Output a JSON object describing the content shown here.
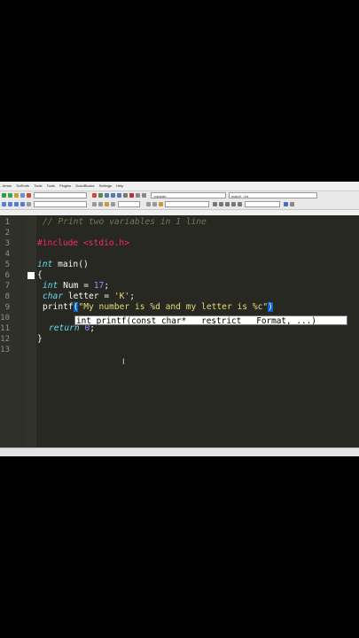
{
  "menu": [
    "...itman",
    "SciSmth",
    "Tools",
    "Tools",
    "Plugins",
    "DocuBlocks",
    "Settings",
    "Help"
  ],
  "toolbar": {
    "scope_combo": "<global>",
    "function_combo": "main() : int"
  },
  "editor": {
    "line_numbers": [
      "1",
      "2",
      "3",
      "4",
      "5",
      "6",
      "7",
      "8",
      "9",
      "10",
      "11",
      "12",
      "13"
    ],
    "line1_comment": "// Print two variables in 1 line",
    "line3_hash": "#",
    "line3_include": "include",
    "line3_header": "<stdio.h>",
    "line5_type": "int",
    "line5_rest": " main()",
    "line6_brace": "{",
    "line7_type": "int",
    "line7_rest": " Num = ",
    "line7_num": "17",
    "line7_semi": ";",
    "line8_type": "char",
    "line8_rest": " letter = ",
    "line8_char": "'K'",
    "line8_semi": ";",
    "line9_func": "printf",
    "line9_open": "(",
    "line9_string": "\"My number is %d and my letter is %c\"",
    "line9_close": ")",
    "line10_kw": "return",
    "line10_num": "0",
    "line10_semi": ";",
    "line11_brace": "}",
    "calltip": "int printf(const char* __restrict __Format, ...)",
    "cursor_glyph": "I"
  },
  "colors": {
    "editor_bg": "#272822",
    "comment": "#75715e",
    "keyword": "#66d9ef",
    "preprocessor": "#f92672",
    "string": "#e6db74",
    "number": "#ae81ff"
  }
}
